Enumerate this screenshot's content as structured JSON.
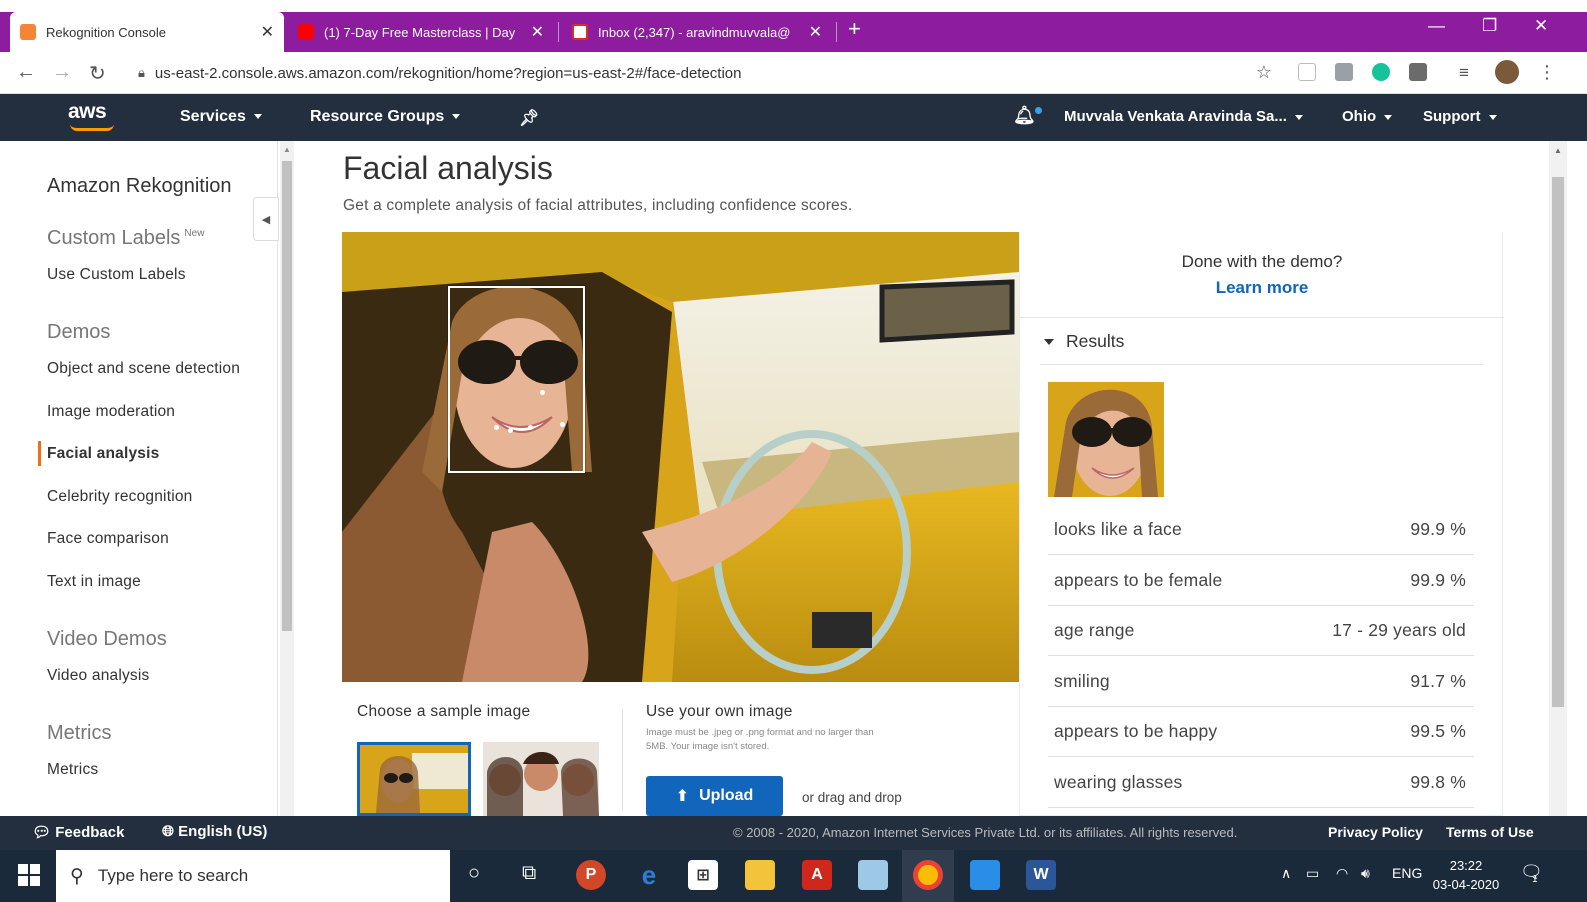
{
  "browser": {
    "tabs": [
      {
        "title": "Rekognition Console",
        "favicon_color": "#f58536"
      },
      {
        "title": "(1) 7-Day Free Masterclass | Day",
        "favicon_color": "#ff0000"
      },
      {
        "title": "Inbox (2,347) - aravindmuvvala@",
        "favicon_color": "#d93025"
      }
    ],
    "url": "us-east-2.console.aws.amazon.com/rekognition/home?region=us-east-2#/face-detection"
  },
  "aws_nav": {
    "logo": "aws",
    "services": "Services",
    "resource_groups": "Resource Groups",
    "user": "Muvvala Venkata Aravinda Sa...",
    "region": "Ohio",
    "support": "Support"
  },
  "sidebar": {
    "title": "Amazon Rekognition",
    "custom_labels": {
      "heading": "Custom Labels",
      "badge": "New",
      "link": "Use Custom Labels"
    },
    "demos": {
      "heading": "Demos",
      "items": [
        "Object and scene detection",
        "Image moderation",
        "Facial analysis",
        "Celebrity recognition",
        "Face comparison",
        "Text in image"
      ]
    },
    "video_demos": {
      "heading": "Video Demos",
      "items": [
        "Video analysis"
      ]
    },
    "metrics": {
      "heading": "Metrics",
      "items": [
        "Metrics"
      ]
    }
  },
  "main": {
    "title": "Facial analysis",
    "subtitle": "Get a complete analysis of facial attributes, including confidence scores.",
    "sample_label": "Choose a sample image",
    "own_label": "Use your own image",
    "own_note": "Image must be .jpeg or .png format and no larger than 5MB. Your image isn't stored.",
    "upload": "Upload",
    "drag_drop": "or drag and drop"
  },
  "panel": {
    "done_question": "Done with the demo?",
    "learn_more": "Learn more",
    "results_heading": "Results",
    "results": [
      {
        "label": "looks like a face",
        "value": "99.9 %"
      },
      {
        "label": "appears to be female",
        "value": "99.9 %"
      },
      {
        "label": "age range",
        "value": "17 - 29 years old"
      },
      {
        "label": "smiling",
        "value": "91.7 %"
      },
      {
        "label": "appears to be happy",
        "value": "99.5 %"
      },
      {
        "label": "wearing glasses",
        "value": "99.8 %"
      }
    ]
  },
  "footer": {
    "feedback": "Feedback",
    "language": "English (US)",
    "copyright": "© 2008 - 2020, Amazon Internet Services Private Ltd. or its affiliates. All rights reserved.",
    "privacy": "Privacy Policy",
    "terms": "Terms of Use"
  },
  "taskbar": {
    "search_placeholder": "Type here to search",
    "lang": "ENG",
    "time": "23:22",
    "date": "03-04-2020",
    "notification_count": "1"
  },
  "colors": {
    "tabstrip": "#8e1c9e",
    "aws_nav": "#232f3e",
    "aws_orange": "#ff9900",
    "link_blue": "#1166bb",
    "active_marker": "#ec7211"
  }
}
